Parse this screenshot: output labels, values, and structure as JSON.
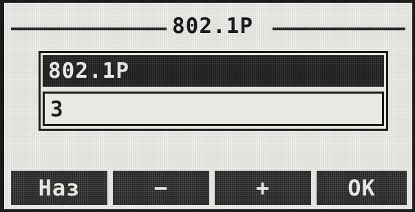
{
  "title": "802.1P",
  "list": {
    "selected_label": "802.1P",
    "value": "3"
  },
  "softkeys": {
    "key1": "Наз",
    "key2": "−",
    "key3": "+",
    "key4": "OK"
  }
}
